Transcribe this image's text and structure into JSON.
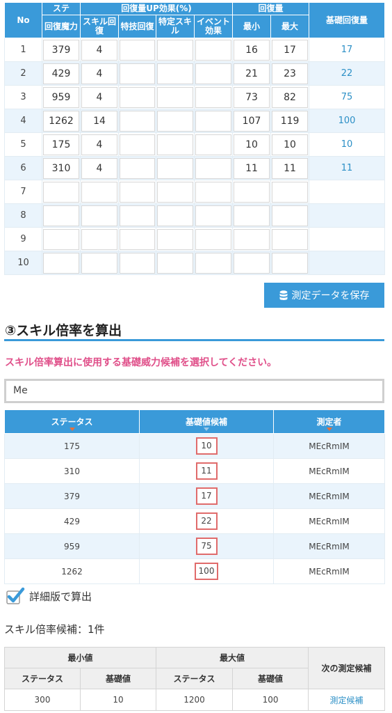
{
  "measure_table": {
    "headers": {
      "no": "No",
      "stat_top": "ステ",
      "stat_bottom": "回復魔力",
      "up_group": "回復量UP効果(%)",
      "skill_heal": "スキル回復",
      "tech_heal": "特技回復",
      "specific_skill": "特定スキル",
      "event_effect": "イベント効果",
      "heal_group": "回復量",
      "min": "最小",
      "max": "最大",
      "base_heal": "基礎回復量"
    },
    "rows": [
      {
        "no": "1",
        "stat": "379",
        "skill": "4",
        "tech": "",
        "specific": "",
        "event": "",
        "min": "16",
        "max": "17",
        "base": "17"
      },
      {
        "no": "2",
        "stat": "429",
        "skill": "4",
        "tech": "",
        "specific": "",
        "event": "",
        "min": "21",
        "max": "23",
        "base": "22"
      },
      {
        "no": "3",
        "stat": "959",
        "skill": "4",
        "tech": "",
        "specific": "",
        "event": "",
        "min": "73",
        "max": "82",
        "base": "75"
      },
      {
        "no": "4",
        "stat": "1262",
        "skill": "14",
        "tech": "",
        "specific": "",
        "event": "",
        "min": "107",
        "max": "119",
        "base": "100"
      },
      {
        "no": "5",
        "stat": "175",
        "skill": "4",
        "tech": "",
        "specific": "",
        "event": "",
        "min": "10",
        "max": "10",
        "base": "10"
      },
      {
        "no": "6",
        "stat": "310",
        "skill": "4",
        "tech": "",
        "specific": "",
        "event": "",
        "min": "11",
        "max": "11",
        "base": "11"
      },
      {
        "no": "7",
        "stat": "",
        "skill": "",
        "tech": "",
        "specific": "",
        "event": "",
        "min": "",
        "max": "",
        "base": ""
      },
      {
        "no": "8",
        "stat": "",
        "skill": "",
        "tech": "",
        "specific": "",
        "event": "",
        "min": "",
        "max": "",
        "base": ""
      },
      {
        "no": "9",
        "stat": "",
        "skill": "",
        "tech": "",
        "specific": "",
        "event": "",
        "min": "",
        "max": "",
        "base": ""
      },
      {
        "no": "10",
        "stat": "",
        "skill": "",
        "tech": "",
        "specific": "",
        "event": "",
        "min": "",
        "max": "",
        "base": ""
      }
    ]
  },
  "save_button": {
    "label": "測定データを保存",
    "icon": "database-icon"
  },
  "section": {
    "title": "③スキル倍率を算出",
    "note": "スキル倍率算出に使用する基礎威力候補を選択してください。"
  },
  "search": {
    "value": "Me"
  },
  "candidate_table": {
    "headers": {
      "status": "ステータス",
      "base": "基礎値候補",
      "measurer": "測定者"
    },
    "rows": [
      {
        "status": "175",
        "base": "10",
        "measurer": "MEcRmIM"
      },
      {
        "status": "310",
        "base": "11",
        "measurer": "MEcRmIM"
      },
      {
        "status": "379",
        "base": "17",
        "measurer": "MEcRmIM"
      },
      {
        "status": "429",
        "base": "22",
        "measurer": "MEcRmIM"
      },
      {
        "status": "959",
        "base": "75",
        "measurer": "MEcRmIM"
      },
      {
        "status": "1262",
        "base": "100",
        "measurer": "MEcRmIM"
      }
    ]
  },
  "detail_checkbox": {
    "label": "詳細版で算出",
    "checked": true,
    "icon": "checkmark-icon"
  },
  "result_count": "スキル倍率候補：1件",
  "result_table": {
    "headers": {
      "min_group": "最小値",
      "max_group": "最大値",
      "next": "次の測定候補",
      "status_min": "ステータス",
      "base_min": "基礎値",
      "status_max": "ステータス",
      "base_max": "基礎値"
    },
    "rows": [
      {
        "status_min": "300",
        "base_min": "10",
        "status_max": "1200",
        "base_max": "100",
        "next": "測定候補"
      }
    ]
  },
  "colors": {
    "header_blue": "#3a9ad9",
    "row_alt": "#eaf4fc",
    "note_pink": "#e0508a",
    "pick_red": "#e06b6b",
    "link_blue": "#2b8fc6"
  }
}
